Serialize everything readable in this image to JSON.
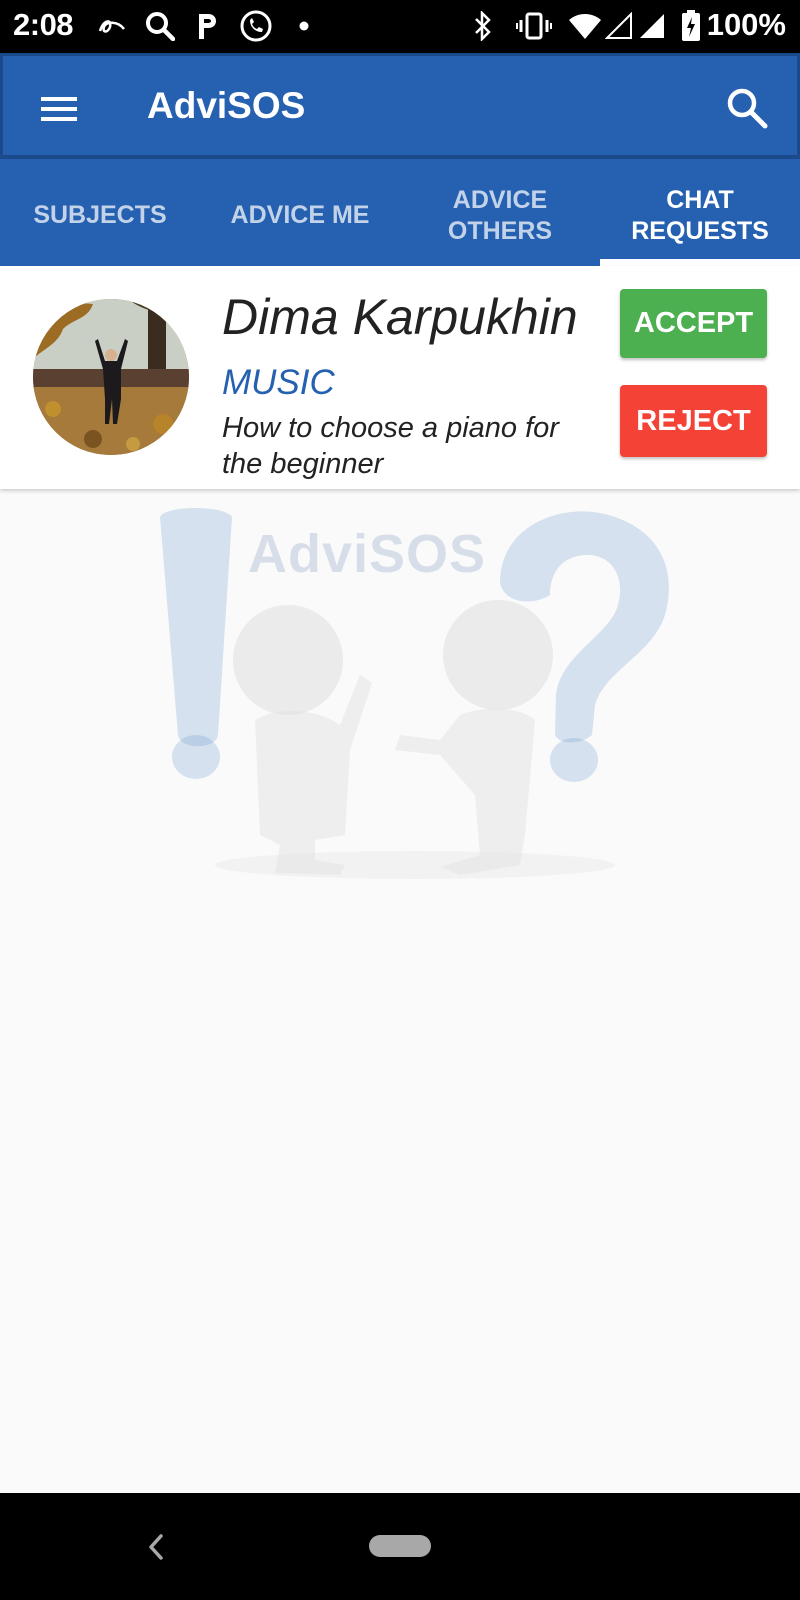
{
  "status_bar": {
    "time": "2:08",
    "battery_percent": "100%",
    "left_icons": [
      "aliexpress-icon",
      "search-icon",
      "parking-icon",
      "whatsapp-icon",
      "notification-dot-icon"
    ],
    "right_icons": [
      "bluetooth-icon",
      "vibrate-icon",
      "wifi-icon",
      "signal-empty-icon",
      "signal-full-icon",
      "battery-charging-icon"
    ]
  },
  "app_bar": {
    "title": "AdviSOS",
    "menu_icon": "hamburger-menu-icon",
    "search_icon": "search-icon",
    "color": "#2561b0"
  },
  "tabs": [
    {
      "label": "SUBJECTS",
      "active": false
    },
    {
      "label": "ADVICE ME",
      "active": false
    },
    {
      "label": "ADVICE\nOTHERS",
      "active": false
    },
    {
      "label": "CHAT\nREQUESTS",
      "active": true
    }
  ],
  "request": {
    "name": "Dima Karpukhin",
    "subject": "MUSIC",
    "question": "How to choose a piano for the beginner",
    "accept_label": "ACCEPT",
    "reject_label": "REJECT",
    "accept_color": "#4caf50",
    "reject_color": "#f44336"
  },
  "watermark": {
    "text": "AdviSOS"
  },
  "nav_bar": {
    "back_icon": "back-chevron-icon",
    "home_icon": "home-pill-icon"
  }
}
